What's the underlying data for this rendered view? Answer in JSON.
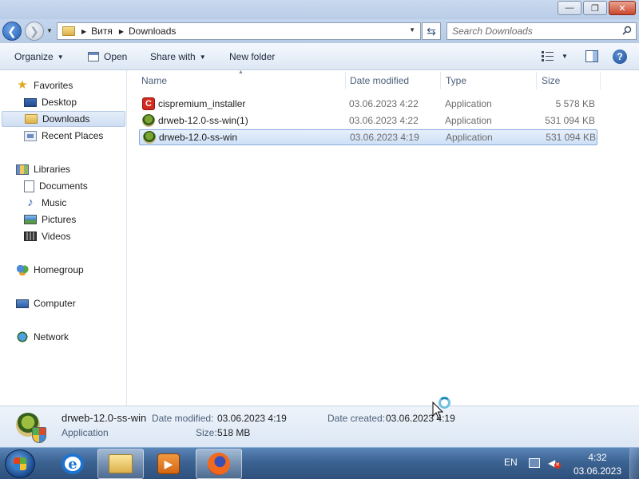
{
  "window": {
    "controls": {
      "minimize": "—",
      "maximize": "❐",
      "close": "✕"
    }
  },
  "address": {
    "crumbs": [
      "Витя",
      "Downloads"
    ],
    "search_placeholder": "Search Downloads"
  },
  "toolbar": {
    "organize": "Organize",
    "open": "Open",
    "share_with": "Share with",
    "new_folder": "New folder",
    "help": "?"
  },
  "nav": {
    "favorites": "Favorites",
    "desktop": "Desktop",
    "downloads": "Downloads",
    "recent_places": "Recent Places",
    "libraries": "Libraries",
    "documents": "Documents",
    "music": "Music",
    "pictures": "Pictures",
    "videos": "Videos",
    "homegroup": "Homegroup",
    "computer": "Computer",
    "network": "Network"
  },
  "columns": {
    "name": "Name",
    "date": "Date modified",
    "type": "Type",
    "size": "Size"
  },
  "files": [
    {
      "name": "cispremium_installer",
      "date": "03.06.2023 4:22",
      "type": "Application",
      "size": "5 578 KB",
      "icon": "cispremium-icon",
      "cis_letter": "C"
    },
    {
      "name": "drweb-12.0-ss-win(1)",
      "date": "03.06.2023 4:22",
      "type": "Application",
      "size": "531 094 KB",
      "icon": "drweb-icon"
    },
    {
      "name": "drweb-12.0-ss-win",
      "date": "03.06.2023 4:19",
      "type": "Application",
      "size": "531 094 KB",
      "icon": "drweb-icon",
      "selected": true
    }
  ],
  "details": {
    "name": "drweb-12.0-ss-win",
    "type": "Application",
    "date_modified_label": "Date modified:",
    "date_modified": "03.06.2023 4:19",
    "date_created_label": "Date created:",
    "date_created": "03.06.2023 4:19",
    "size_label": "Size:",
    "size": "518 MB"
  },
  "taskbar": {
    "language": "EN",
    "time": "4:32",
    "date": "03.06.2023",
    "media_glyph": "▶"
  }
}
